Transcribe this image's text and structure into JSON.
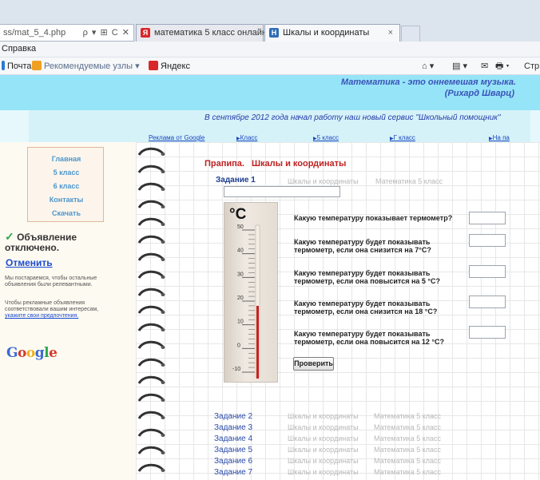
{
  "browser": {
    "address": "ss/mat_5_4.php",
    "address_controls": "ρ ▾ ⊞ C ✕",
    "tabs": [
      {
        "label": "математика 5 класс онлайн ...",
        "favicon": "Я",
        "favicon_color": "#d9262b"
      },
      {
        "label": "Шкалы и координаты",
        "favicon": "H",
        "favicon_color": "#2f6db5",
        "close": "×"
      }
    ],
    "menu": {
      "help": "Справка"
    },
    "favorites": {
      "mail": "Почта",
      "recommended": "Рекомендуемые узлы ▾",
      "yandex": "Яндекс"
    },
    "commands": {
      "home": "⌂ ▾",
      "feeds": "▤ ▾",
      "mail": "✉",
      "print": "🖶 ▾",
      "page": "Стр"
    }
  },
  "header": {
    "quote": "Математика - это оннемешая музыка.",
    "quote_author": "(Рихард Шварц)",
    "announcement": "В сентябре 2012 года начал работу наш новый сервис \"Школьный помощник\""
  },
  "ads_row": {
    "google": "Реклама от Google",
    "links": [
      "Класс",
      "5 класс",
      "Г класс",
      "На па"
    ]
  },
  "nav": {
    "items": [
      "Главная",
      "5 класс",
      "6 класс",
      "Контакты",
      "Скачать"
    ]
  },
  "ad_notice": {
    "check": "✓",
    "title": "Объявление отключено.",
    "cancel": "Отменить",
    "text1": "Мы постараемся, чтобы остальные объявления были релевантными.",
    "text2": "Чтобы рекламные объявления соответствовали вашим интересам,",
    "text2_link": "укажите свои предпочтения.",
    "google_logo": "Google"
  },
  "main": {
    "title_part1": "Прапипа.",
    "title_part2": "Шкалы и координаты",
    "task_label": "Задание 1",
    "task_topic": "Шкалы и координаты",
    "task_class": "Математика 5 класс"
  },
  "thermometer": {
    "unit": "°C",
    "scale": [
      50,
      40,
      30,
      20,
      10,
      0,
      -10
    ],
    "reading": 18,
    "mercury_color": "#c62121"
  },
  "questions": [
    "Какую температуру показывает термометр?",
    "Какую температуру будет показывать термометр, если она снизится на 7°С?",
    "Какую температуру будет показывать термометр, если она повысится на 5 °С?",
    "Какую температуру будет показывать термометр, если она снизится на 18 °С?",
    "Какую температуру будет показывать термометр, если она повысится на 12 °С?"
  ],
  "check_button": "Проверить",
  "tasks": [
    {
      "label": "Задание 2",
      "topic": "Шкалы и координаты",
      "class": "Математика 5 класс"
    },
    {
      "label": "Задание 3",
      "topic": "Шкалы и координаты",
      "class": "Математика 5 класс"
    },
    {
      "label": "Задание 4",
      "topic": "Шкалы и координаты",
      "class": "Математика 5 класс"
    },
    {
      "label": "Задание 5",
      "topic": "Шкалы и координаты",
      "class": "Математика 5 класс"
    },
    {
      "label": "Задание 6",
      "topic": "Шкалы и координаты",
      "class": "Математика 5 класс"
    },
    {
      "label": "Задание 7",
      "topic": "Шкалы и координаты",
      "class": "Математика 5 класс"
    }
  ]
}
